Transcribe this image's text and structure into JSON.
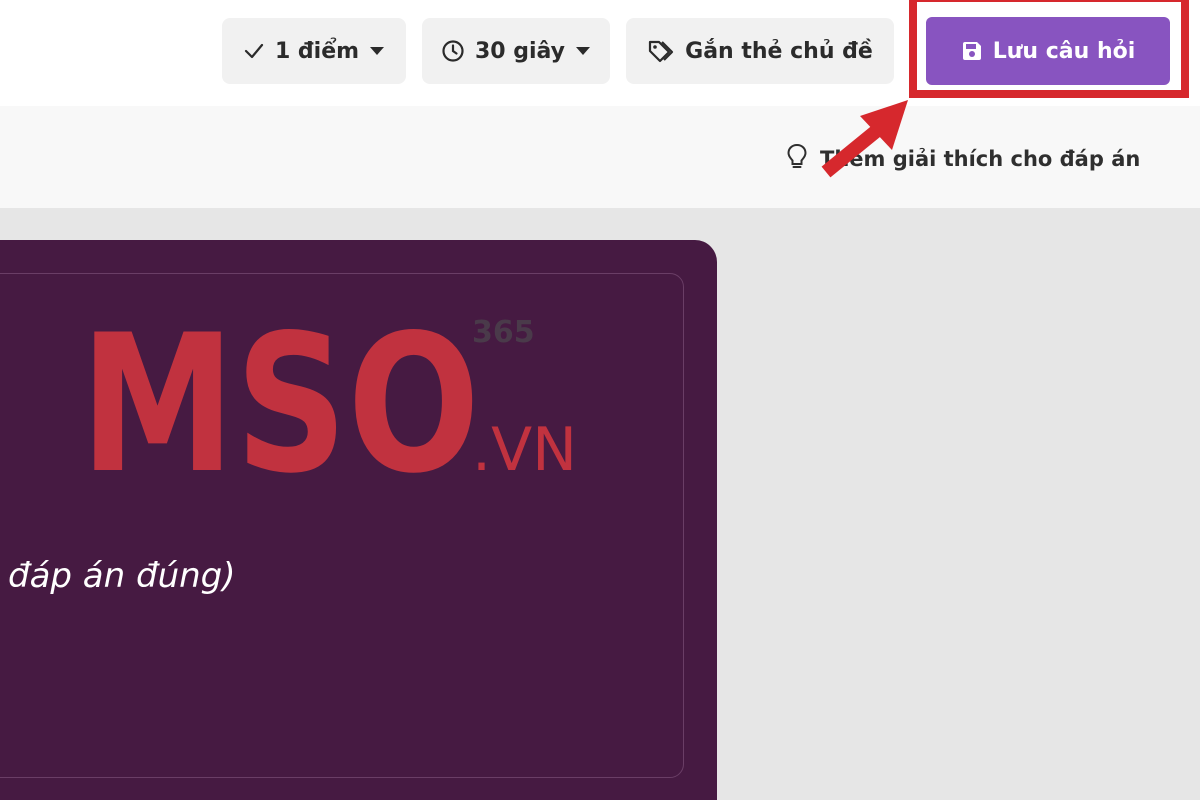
{
  "toolbar": {
    "points": {
      "label": "1 điểm",
      "icon": "check-icon",
      "caret": "caret-down-icon"
    },
    "time": {
      "label": "30 giây",
      "icon": "clock-icon",
      "caret": "caret-down-icon"
    },
    "tag": {
      "label": "Gắn thẻ chủ đề",
      "icon": "tag-icon"
    },
    "save": {
      "label": "Lưu câu hỏi",
      "icon": "save-icon"
    }
  },
  "explanation": {
    "label": "Thêm giải thích cho đáp án",
    "icon": "lightbulb-icon"
  },
  "question": {
    "text": "đáp án đúng)"
  },
  "watermark": {
    "brand": "MSO",
    "suffix": ".VN",
    "badge": "365"
  },
  "colors": {
    "accent": "#8854c0",
    "highlight": "#d6282d",
    "card": "#461a42",
    "logo": "#c1323f"
  }
}
